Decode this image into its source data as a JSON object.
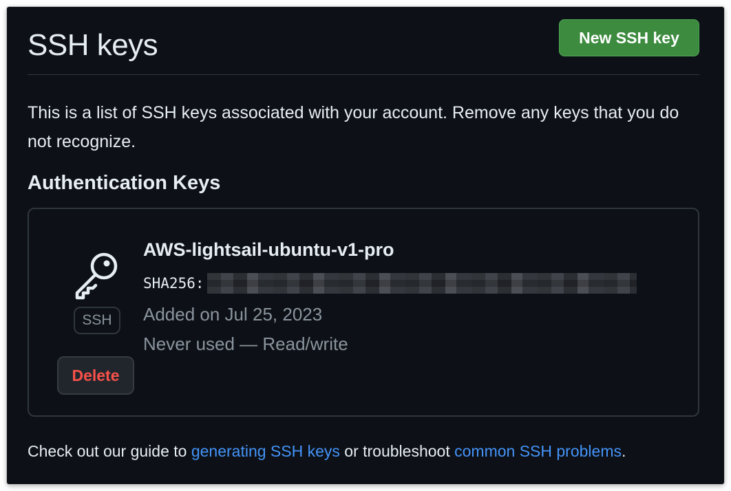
{
  "page": {
    "title": "SSH keys",
    "new_key_button": "New SSH key",
    "intro": "This is a list of SSH keys associated with your account. Remove any keys that you do not recognize."
  },
  "section": {
    "title": "Authentication Keys"
  },
  "key": {
    "icon": "key-icon",
    "badge": "SSH",
    "delete_label": "Delete",
    "name": "AWS-lightsail-ubuntu-v1-pro",
    "fingerprint_label": "SHA256:",
    "added": "Added on Jul 25, 2023",
    "usage": "Never used — Read/write"
  },
  "footer": {
    "text_before": "Check out our guide to ",
    "link1": "generating SSH keys",
    "text_middle": " or troubleshoot ",
    "link2": "common SSH problems",
    "text_after": "."
  },
  "colors": {
    "background": "#0d1117",
    "primary_button": "#3d8b3f",
    "danger": "#f85149",
    "link": "#4493f8",
    "muted_text": "#8b949e",
    "border": "#30363d"
  }
}
